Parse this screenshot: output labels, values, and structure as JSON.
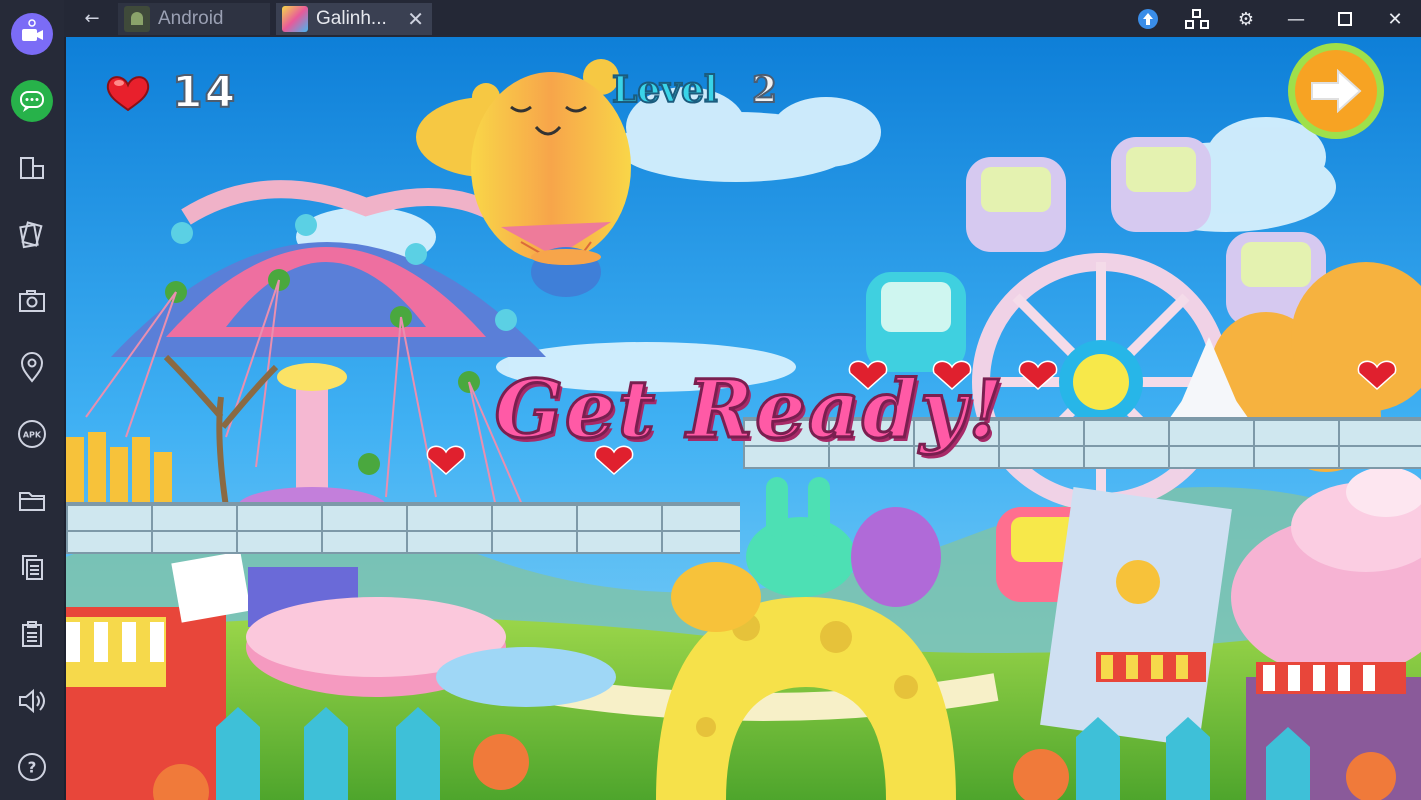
{
  "window": {
    "tabs": [
      {
        "label": "Android"
      },
      {
        "label": "Galinh..."
      }
    ],
    "controls": [
      "upload-icon",
      "multi-instance-icon",
      "gear-icon",
      "minimize-icon",
      "maximize-icon",
      "close-icon"
    ]
  },
  "sidebar": {
    "items": [
      "video-call-icon",
      "chat-icon",
      "rotate-screen-icon",
      "shake-icon",
      "screenshot-icon",
      "location-icon",
      "apk-icon",
      "folder-icon",
      "copy-icon",
      "paste-icon",
      "volume-icon",
      "help-icon"
    ],
    "apk_label": "APK",
    "help_label": "?"
  },
  "game": {
    "lives": "14",
    "level_label": "Level",
    "level_number": "2",
    "status": "Get Ready!",
    "next_button": "arrow-right-icon"
  },
  "colors": {
    "accent_purple": "#7b6cf6",
    "accent_green": "#27b24a",
    "title_pink": "#ff5aa6",
    "level_cyan": "#39d4e8",
    "next_orange": "#f7a323"
  }
}
